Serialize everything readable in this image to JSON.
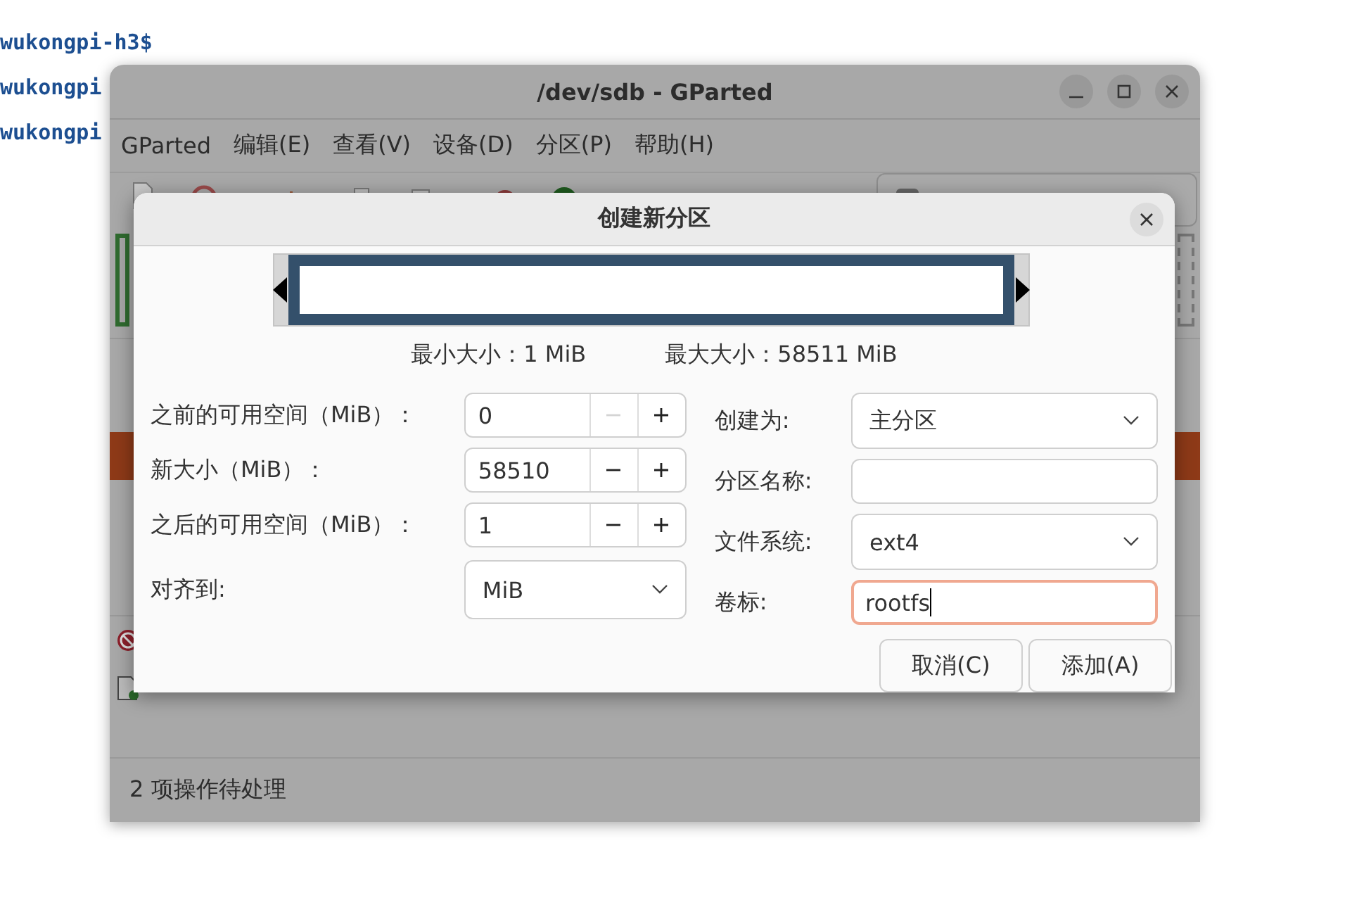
{
  "terminal": {
    "lines": [
      "wukongpi-h3$",
      "wukongpi",
      "wukongpi"
    ]
  },
  "main_window": {
    "title": "/dev/sdb - GParted",
    "menu": [
      "GParted",
      "编辑(E)",
      "查看(V)",
      "设备(D)",
      "分区(P)",
      "帮助(H)"
    ],
    "operations": [
      {
        "kind": "blocked"
      },
      {
        "kind": "create"
      }
    ],
    "status": "2 项操作待处理"
  },
  "dialog": {
    "title": "创建新分区",
    "min_size": "最小大小：1 MiB",
    "max_size": "最大大小：58511 MiB",
    "left_fields": [
      {
        "kind": "spin",
        "label": "之前的可用空间（MiB）：",
        "value": "0",
        "minus_disabled": true
      },
      {
        "kind": "spin",
        "label": "新大小（MiB）：",
        "value": "58510",
        "minus_disabled": false
      },
      {
        "kind": "spin",
        "label": "之后的可用空间（MiB）：",
        "value": "1",
        "minus_disabled": false
      },
      {
        "kind": "combo",
        "label": "对齐到:",
        "value": "MiB"
      }
    ],
    "right_fields": [
      {
        "kind": "combo",
        "label": "创建为:",
        "value": "主分区"
      },
      {
        "kind": "entry",
        "label": "分区名称:",
        "focused": false
      },
      {
        "kind": "combo",
        "label": "文件系统:",
        "value": "ext4"
      },
      {
        "kind": "entry",
        "label": "卷标:",
        "value": "rootfs",
        "focused": true
      }
    ],
    "buttons": [
      "取消(C)",
      "添加(A)"
    ]
  }
}
